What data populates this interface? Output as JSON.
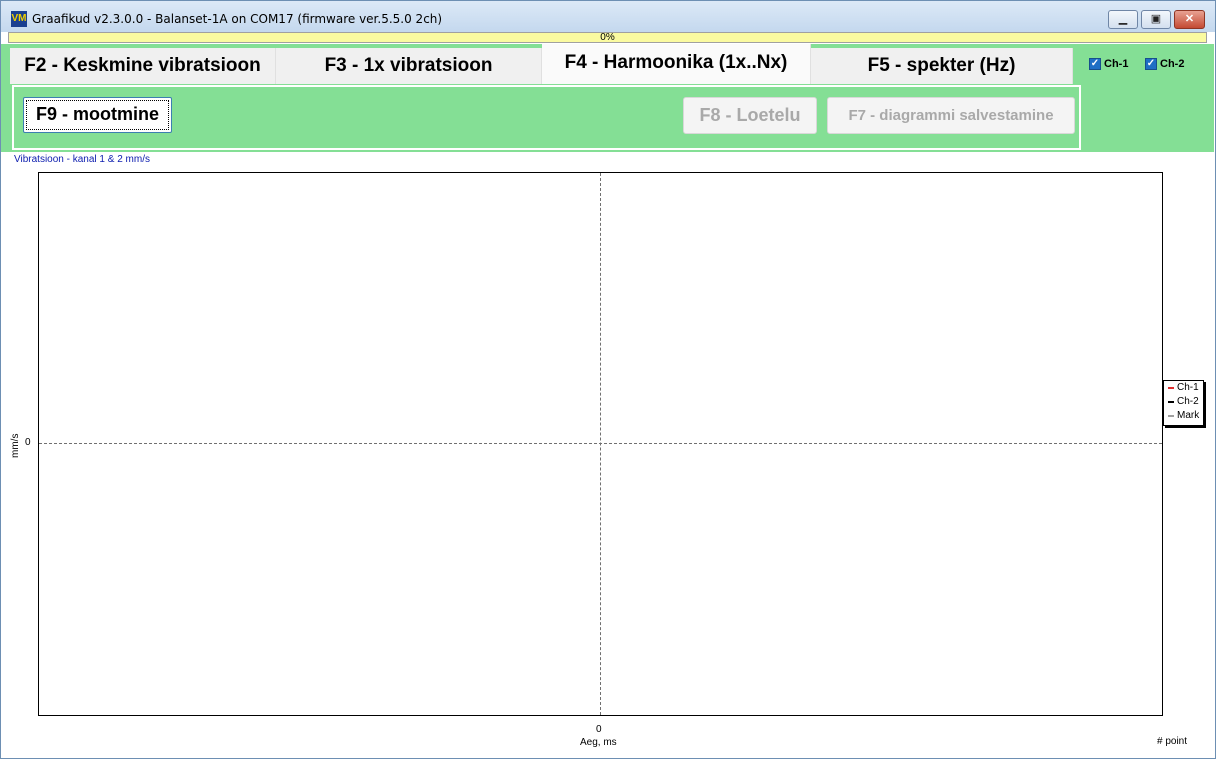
{
  "window": {
    "title": "Graafikud v2.3.0.0 - Balanset-1A on COM17 (firmware ver.5.5.0 2ch)",
    "icon": "VM",
    "minimize_icon": "minimize-icon",
    "maximize_icon": "maximize-icon",
    "close_icon": "close-icon"
  },
  "progress": {
    "label": "0%",
    "value": 0
  },
  "tabs": [
    {
      "label": "F2 - Keskmine vibratsioon",
      "active": false
    },
    {
      "label": "F3 - 1x vibratsioon",
      "active": false
    },
    {
      "label": "F4 - Harmoonika (1x..Nx)",
      "active": true
    },
    {
      "label": "F5 - spekter (Hz)",
      "active": false
    }
  ],
  "channels": [
    {
      "label": "Ch-1",
      "checked": true
    },
    {
      "label": "Ch-2",
      "checked": true
    }
  ],
  "toolbar": {
    "measure_label": "F9 - mootmine",
    "list_label": "F8 - Loetelu",
    "save_label": "F7 - diagrammi salvestamine"
  },
  "chart_data": {
    "type": "line",
    "title": "Vibratsioon  - kanal 1 & 2 mm/s",
    "xlabel": "Aeg, ms",
    "ylabel": "mm/s",
    "x_right_label": "# point",
    "x_ticks": [
      "0"
    ],
    "y_ticks": [
      "0"
    ],
    "series": [
      {
        "name": "Ch-1",
        "color": "#ff0000",
        "values": []
      },
      {
        "name": "Ch-2",
        "color": "#000000",
        "values": []
      },
      {
        "name": "Mark",
        "color": "#a0a0a0",
        "values": []
      }
    ],
    "grid": "dashed center lines",
    "legend_placement": "right"
  },
  "colors": {
    "panel_green": "#84df95",
    "progress_yellow": "#fafaa0",
    "title_blue": "#1020b0"
  }
}
